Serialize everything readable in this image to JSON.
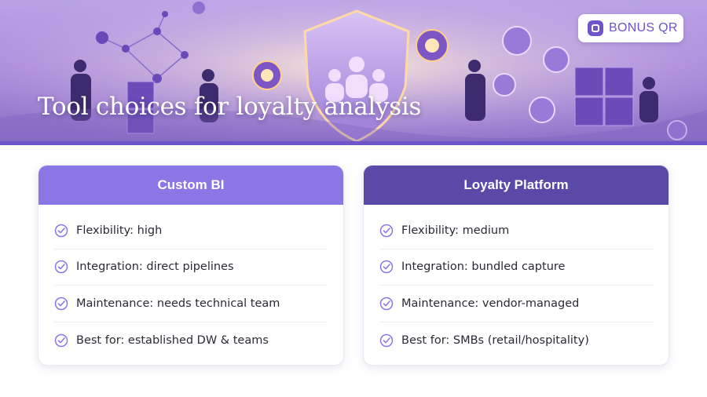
{
  "hero": {
    "title": "Tool choices for loyalty analysis"
  },
  "brand": {
    "name": "BONUS QR",
    "icon": "bonus-qr-logo-icon"
  },
  "colors": {
    "left_header": "#8b76e6",
    "right_header": "#5b49a8",
    "accent": "#6f54c9",
    "check": "#8b76e6"
  },
  "cards": [
    {
      "title": "Custom BI",
      "items": [
        "Flexibility: high",
        "Integration: direct pipelines",
        "Maintenance: needs technical team",
        "Best for: established DW & teams"
      ]
    },
    {
      "title": "Loyalty Platform",
      "items": [
        "Flexibility: medium",
        "Integration: bundled capture",
        "Maintenance: vendor-managed",
        "Best for: SMBs (retail/hospitality)"
      ]
    }
  ]
}
